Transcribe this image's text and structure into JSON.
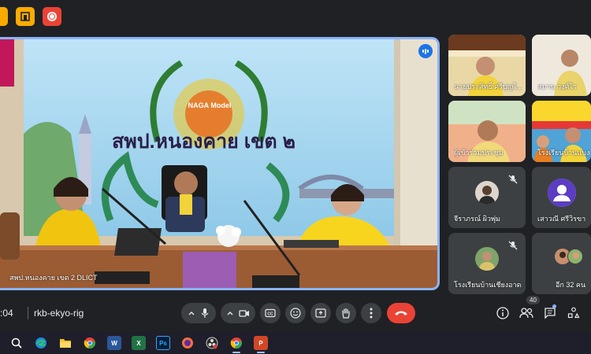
{
  "top_icons": [
    {
      "name": "meet-app-icon-partial",
      "color": "#f9ab00"
    },
    {
      "name": "whiteboard-icon",
      "glyph": "⊟",
      "color": "#f9ab00"
    },
    {
      "name": "recording-icon",
      "color": "#ea4335"
    }
  ],
  "main_video": {
    "banner_title": "สพป.หนองคาย เขต ๒",
    "logo_text": "NAGA Model",
    "name_label": "สพป.หนองคาย เขต 2 DLICT"
  },
  "participants": [
    {
      "name": "นายประสิทธิ์ ศรีบุญไ...",
      "type": "video",
      "muted": false
    },
    {
      "name": "สมาน วงศ์ไว",
      "type": "video",
      "muted": false
    },
    {
      "name": "ผู้เข้าร่วมประชุม",
      "type": "video",
      "muted": false
    },
    {
      "name": "โรงเรียนบ้านแบง",
      "type": "video",
      "muted": false
    },
    {
      "name": "จีราภรณ์ ผิวพุ่ม",
      "type": "avatar-photo",
      "muted": true
    },
    {
      "name": "เสาวณี ศรีวิรขา",
      "type": "avatar-icon",
      "muted": false
    },
    {
      "name": "โรงเรียนบ้านเชียงอาด",
      "type": "avatar-photo",
      "muted": true
    },
    {
      "name": "อีก 32 คน",
      "type": "more",
      "muted": false
    }
  ],
  "meeting": {
    "time": ":04",
    "code": "rkb-ekyo-rig",
    "participant_count": "40"
  },
  "controls": [
    {
      "name": "mic",
      "icon": "mic-icon"
    },
    {
      "name": "camera",
      "icon": "camera-icon"
    },
    {
      "name": "captions",
      "icon": "captions-icon"
    },
    {
      "name": "reactions",
      "icon": "emoji-icon"
    },
    {
      "name": "present",
      "icon": "present-icon"
    },
    {
      "name": "raise-hand",
      "icon": "hand-icon"
    },
    {
      "name": "more",
      "icon": "more-vert-icon"
    },
    {
      "name": "leave",
      "icon": "phone-hangup-icon",
      "color": "#ea4335"
    }
  ],
  "taskbar": [
    "search",
    "edge",
    "file-explorer",
    "chrome",
    "word",
    "excel",
    "photoshop",
    "firefox",
    "obs",
    "chrome-2",
    "powerpoint"
  ]
}
